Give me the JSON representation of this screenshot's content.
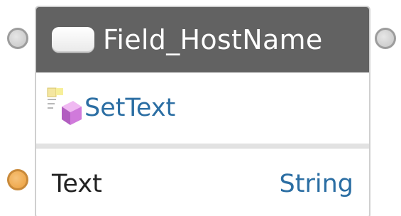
{
  "node": {
    "title": "Field_HostName",
    "method": "SetText",
    "method_icon": "set-text-method-icon",
    "param": {
      "name": "Text",
      "type": "String"
    }
  },
  "colors": {
    "header_bg": "#626262",
    "method_text": "#2b6ea3",
    "exec_port": "#c4c4c4",
    "text_port": "#ec9f3c"
  }
}
